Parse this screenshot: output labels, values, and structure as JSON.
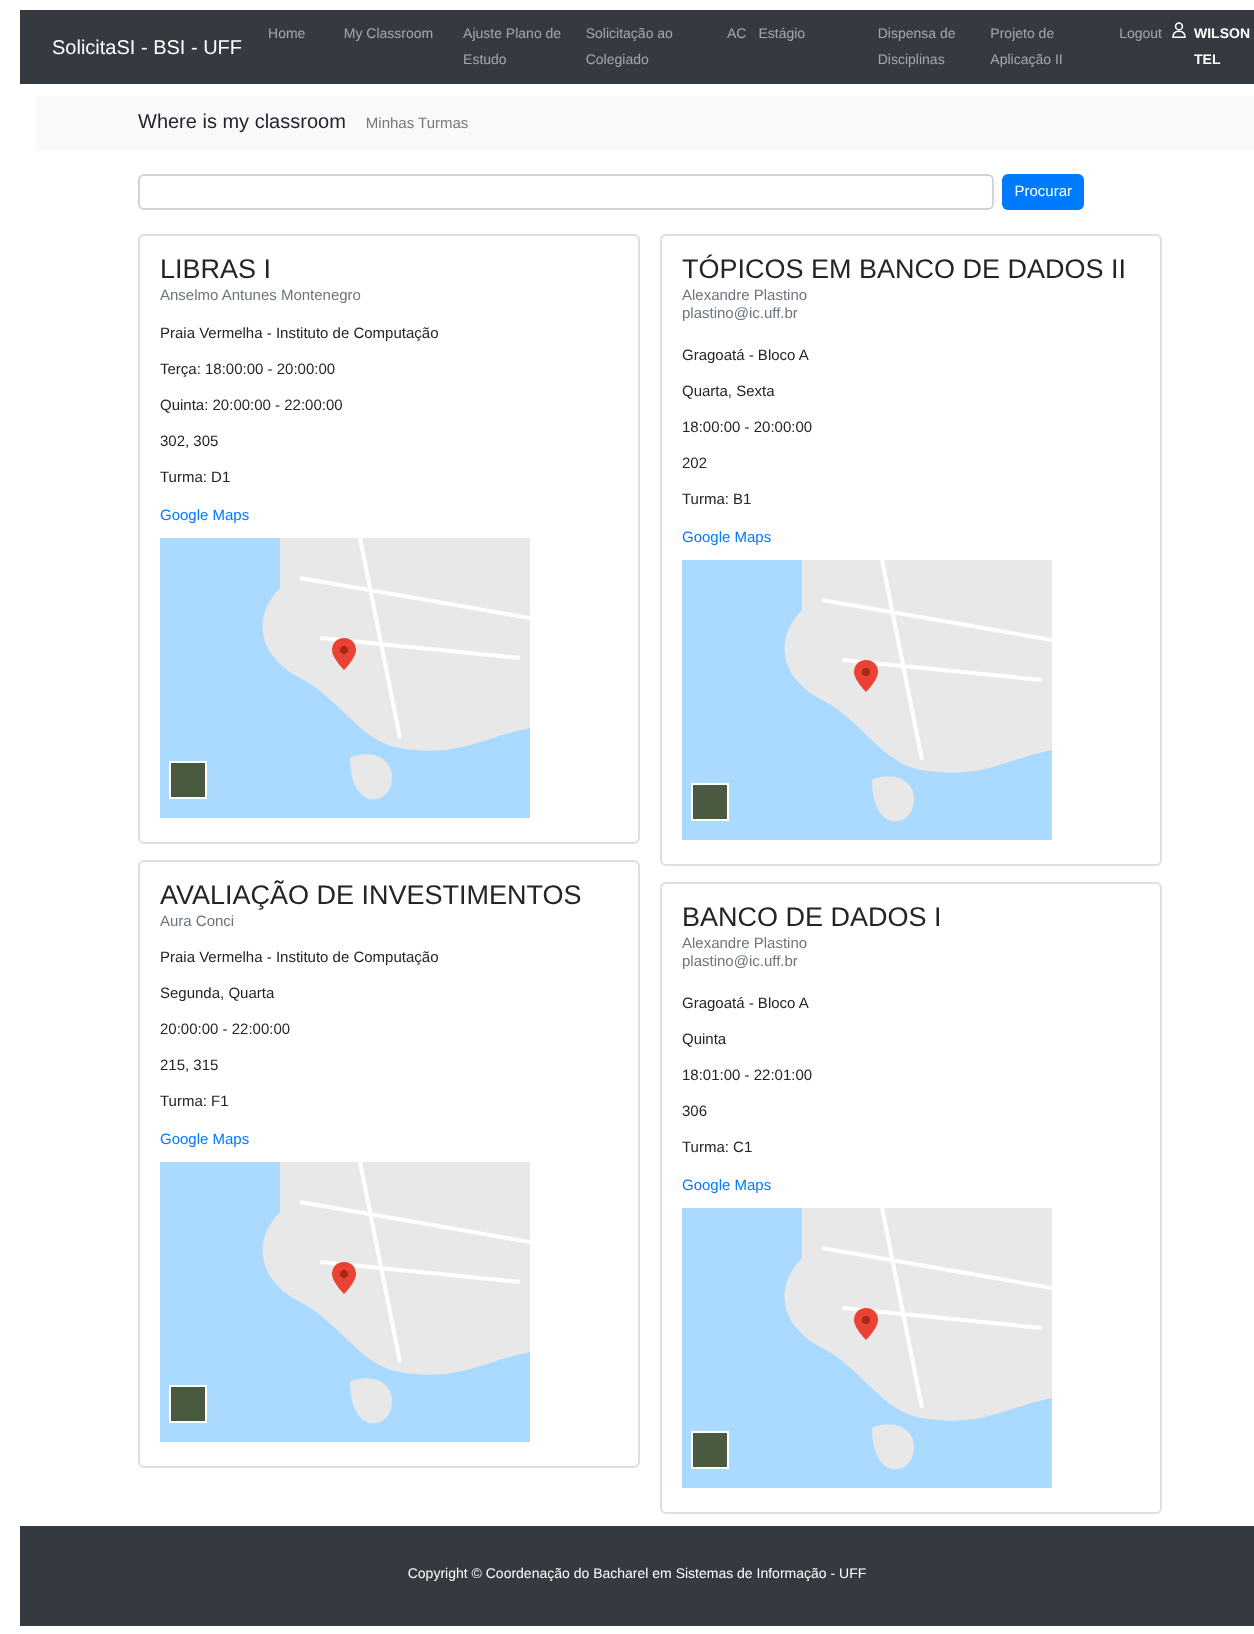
{
  "navbar": {
    "brand": "SolicitaSI - BSI - UFF",
    "links": [
      {
        "label": "Home"
      },
      {
        "label": "My Classroom"
      },
      {
        "label": "Ajuste Plano de Estudo"
      },
      {
        "label": "Solicitação ao Colegiado"
      },
      {
        "label": "AC"
      },
      {
        "label": "Estágio"
      },
      {
        "label": "Dispensa de Disciplinas"
      },
      {
        "label": "Projeto de Aplicação II"
      }
    ],
    "logout": "Logout",
    "user": "WILSON TEL"
  },
  "subnav": {
    "title": "Where is my classroom",
    "link": "Minhas Turmas"
  },
  "search": {
    "button": "Procurar"
  },
  "columns": [
    {
      "cards": [
        {
          "title": "LIBRAS I",
          "teacher": "Anselmo Antunes Montenegro",
          "lines": [
            "Praia Vermelha - Instituto de Computação",
            "Terça: 18:00:00 - 20:00:00",
            "Quinta: 20:00:00 - 22:00:00",
            "302, 305",
            "Turma: D1"
          ],
          "link": "Google Maps"
        },
        {
          "title": "AVALIAÇÃO DE INVESTIMENTOS",
          "teacher": "Aura Conci",
          "lines": [
            "Praia Vermelha - Instituto de Computação",
            "Segunda, Quarta",
            "20:00:00 - 22:00:00",
            "215, 315",
            "Turma: F1"
          ],
          "link": "Google Maps"
        }
      ]
    },
    {
      "cards": [
        {
          "title": "TÓPICOS EM BANCO DE DADOS II",
          "teacher": "Alexandre Plastino",
          "email": "plastino@ic.uff.br",
          "lines": [
            "Gragoatá - Bloco A",
            "Quarta, Sexta",
            "18:00:00 - 20:00:00",
            "202",
            "Turma: B1"
          ],
          "link": "Google Maps"
        },
        {
          "title": "BANCO DE DADOS I",
          "teacher": "Alexandre Plastino",
          "email": "plastino@ic.uff.br",
          "lines": [
            "Gragoatá - Bloco A",
            "Quinta",
            "18:01:00 - 22:01:00",
            "306",
            "Turma: C1"
          ],
          "link": "Google Maps"
        }
      ]
    }
  ],
  "footer": "Copyright © Coordenação do Bacharel em Sistemas de Informação - UFF"
}
